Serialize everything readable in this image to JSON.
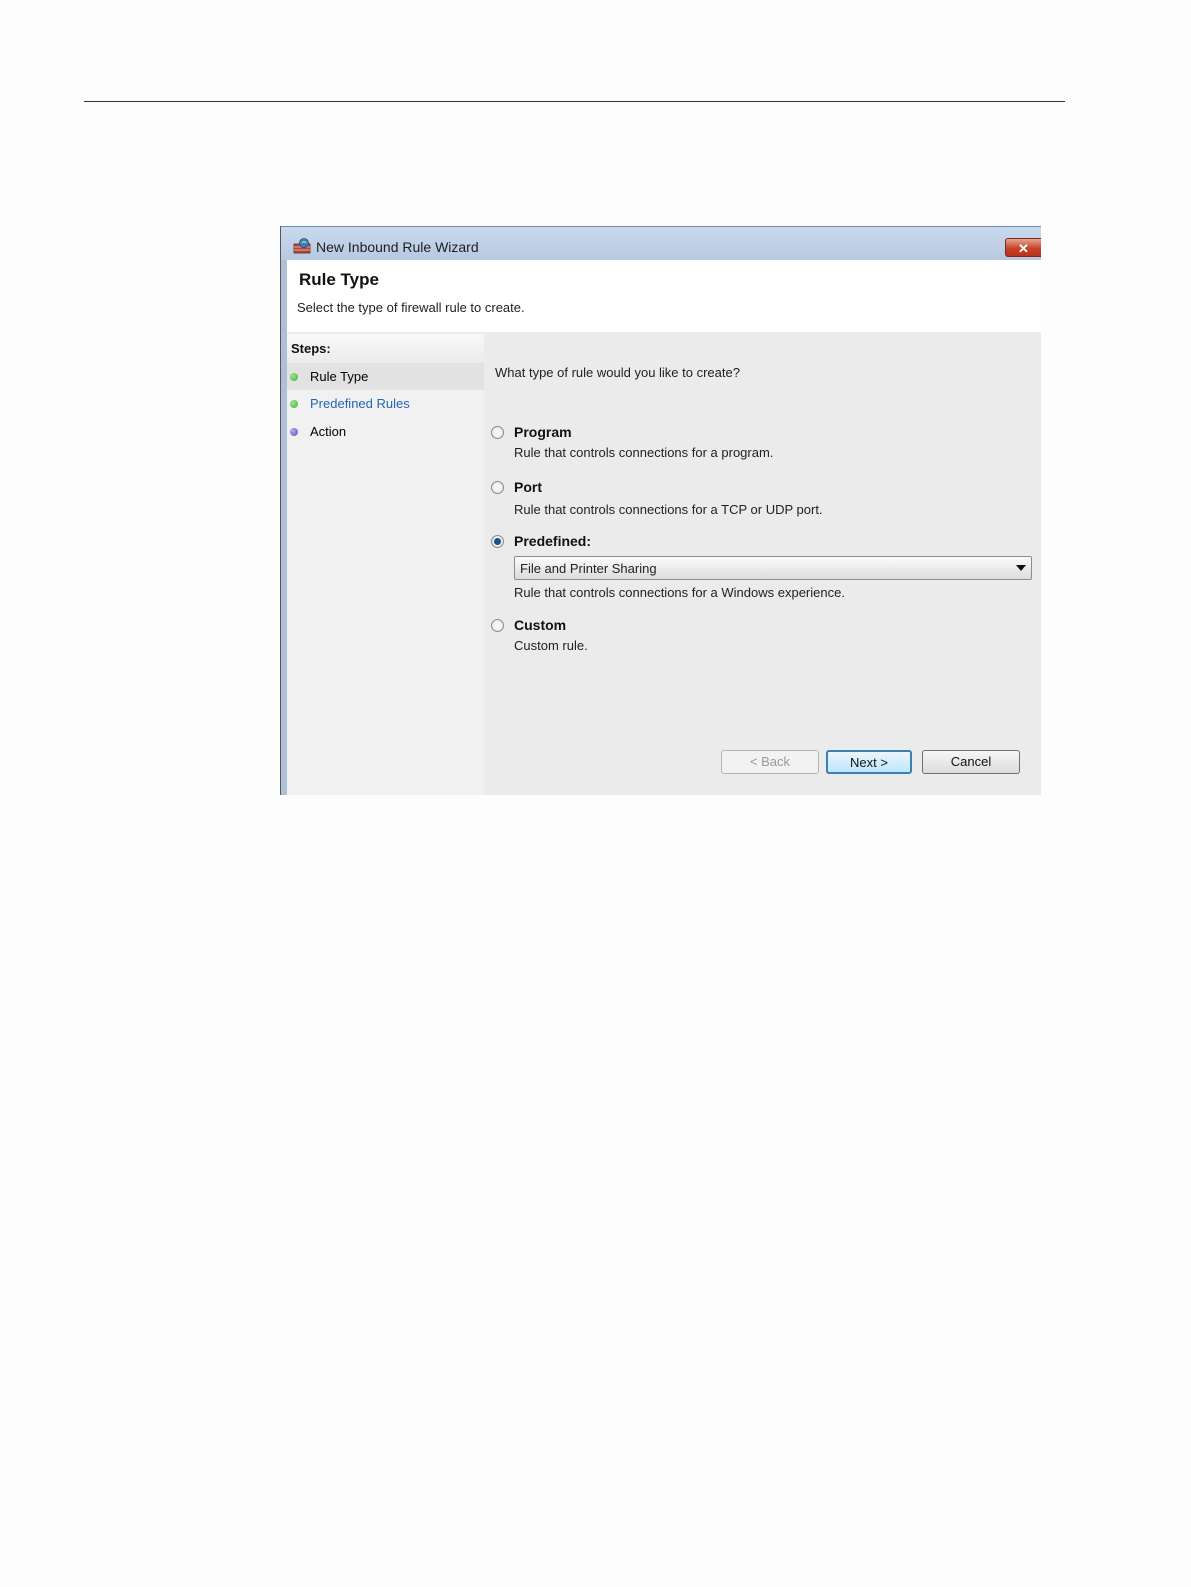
{
  "window": {
    "title": "New Inbound Rule Wizard",
    "close_glyph": "✕",
    "icon": "firewall-shield-icon"
  },
  "header": {
    "title": "Rule Type",
    "subtitle": "Select the type of firewall rule to create."
  },
  "steps": {
    "heading": "Steps:",
    "items": [
      {
        "label": "Rule Type",
        "color": "#3fae3a",
        "selected": true
      },
      {
        "label": "Predefined Rules",
        "color": "#3fae3a",
        "link_color": "#1f66b5"
      },
      {
        "label": "Action",
        "color": "#5a4fc0"
      }
    ]
  },
  "main": {
    "question": "What type of rule would you like to create?",
    "options": [
      {
        "label": "Program",
        "description": "Rule that controls connections for a program.",
        "checked": false
      },
      {
        "label": "Port",
        "description": "Rule that controls connections for a TCP or UDP port.",
        "checked": false
      },
      {
        "label": "Predefined:",
        "description": "Rule that controls connections for a Windows experience.",
        "checked": true
      },
      {
        "label": "Custom",
        "description": "Custom rule.",
        "checked": false
      }
    ],
    "predefined_select": {
      "value": "File and Printer Sharing"
    }
  },
  "buttons": {
    "back": "< Back",
    "next": "Next >",
    "cancel": "Cancel"
  }
}
